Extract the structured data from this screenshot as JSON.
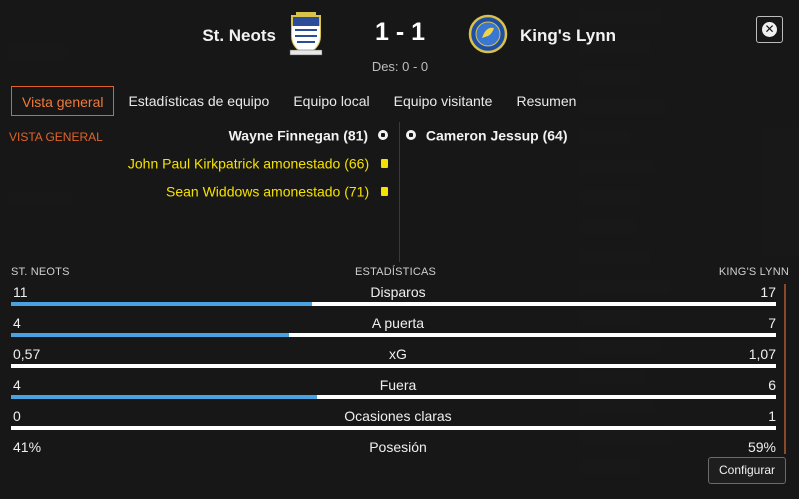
{
  "match": {
    "home_team": "St. Neots",
    "away_team": "King's Lynn",
    "score": "1 - 1",
    "halftime": "Des: 0 - 0"
  },
  "tabs": [
    {
      "label": "Vista general",
      "active": true
    },
    {
      "label": "Estadísticas de equipo",
      "active": false
    },
    {
      "label": "Equipo local",
      "active": false
    },
    {
      "label": "Equipo visitante",
      "active": false
    },
    {
      "label": "Resumen",
      "active": false
    }
  ],
  "overview": {
    "section_label": "VISTA GENERAL",
    "home_events": [
      {
        "type": "goal",
        "text": "Wayne Finnegan (81)"
      },
      {
        "type": "yellow-card",
        "text": "John Paul Kirkpatrick amonestado (66)"
      },
      {
        "type": "yellow-card",
        "text": "Sean Widdows amonestado (71)"
      }
    ],
    "away_events": [
      {
        "type": "goal",
        "text": "Cameron Jessup (64)"
      }
    ]
  },
  "stats": {
    "home_header": "ST. NEOTS",
    "center_header": "ESTADÍSTICAS",
    "away_header": "KING'S LYNN",
    "rows": [
      {
        "label": "Disparos",
        "home": "11",
        "away": "17",
        "home_share": 0.393
      },
      {
        "label": "A puerta",
        "home": "4",
        "away": "7",
        "home_share": 0.364
      },
      {
        "label": "xG",
        "home": "0,57",
        "away": "1,07",
        "home_share": 0.0
      },
      {
        "label": "Fuera",
        "home": "4",
        "away": "6",
        "home_share": 0.4
      },
      {
        "label": "Ocasiones claras",
        "home": "0",
        "away": "1",
        "home_share": 0.0
      },
      {
        "label": "Posesión",
        "home": "41%",
        "away": "59%",
        "home_share": 0.41
      }
    ]
  },
  "buttons": {
    "configure": "Configurar",
    "close_icon": "close-icon"
  },
  "colors": {
    "accent": "#e0642a",
    "bar_home": "#4aa3e0",
    "bar_base": "#ffffff",
    "yellow_card": "#f5e100"
  }
}
